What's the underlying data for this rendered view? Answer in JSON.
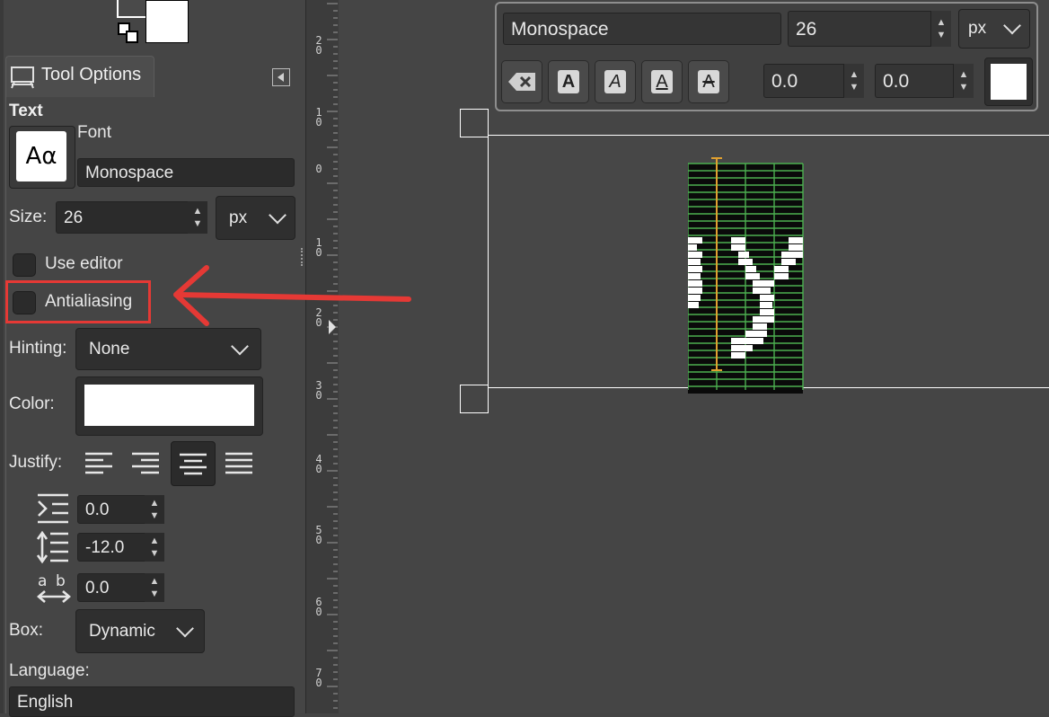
{
  "tool_options": {
    "tab_label": "Tool Options",
    "section_title": "Text",
    "font_label": "Font",
    "font_preview": "Aα",
    "font_value": "Monospace",
    "size_label": "Size:",
    "size_value": "26",
    "size_unit": "px",
    "use_editor_label": "Use editor",
    "use_editor_checked": false,
    "antialiasing_label": "Antialiasing",
    "antialiasing_checked": false,
    "hinting_label": "Hinting:",
    "hinting_value": "None",
    "color_label": "Color:",
    "color_value": "#ffffff",
    "justify_label": "Justify:",
    "justify_active": "center",
    "indent_value": "0.0",
    "line_spacing_value": "-12.0",
    "letter_spacing_value": "0.0",
    "box_label": "Box:",
    "box_value": "Dynamic",
    "language_label": "Language:",
    "language_value": "English"
  },
  "ruler_labels": [
    [
      "2",
      "0"
    ],
    [
      "1",
      "0"
    ],
    [
      "0"
    ],
    [
      "1",
      "0"
    ],
    [
      "2",
      "0"
    ],
    [
      "3",
      "0"
    ],
    [
      "4",
      "0"
    ],
    [
      "5",
      "0"
    ],
    [
      "6",
      "0"
    ],
    [
      "7",
      "0"
    ]
  ],
  "on_canvas_toolbar": {
    "font_value": "Monospace",
    "size_value": "26",
    "size_unit": "px",
    "baseline_value": "0.0",
    "kerning_value": "0.0",
    "color_value": "#ffffff",
    "style_buttons": [
      "clear-style",
      "bold",
      "italic",
      "underline",
      "strikethrough"
    ]
  },
  "canvas_text": "y",
  "annotation": {
    "color": "#e53935"
  },
  "colors": {
    "background": "#454545",
    "highlight": "#e53935",
    "text_guides": "#4caf50",
    "cursor": "#e0a030"
  }
}
